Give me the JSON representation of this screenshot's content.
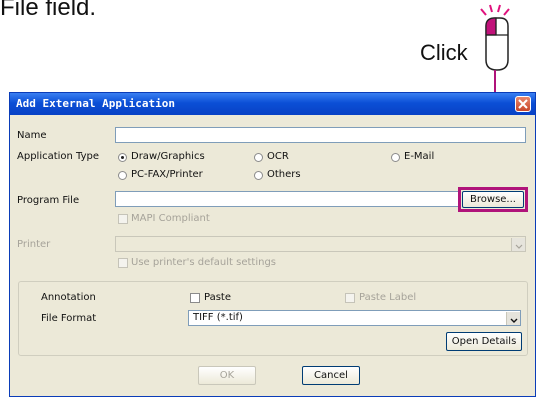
{
  "caption": "File field.",
  "click_label": "Click",
  "dialog": {
    "title": "Add External Application",
    "name_label": "Name",
    "name_value": "",
    "app_type_label": "Application Type",
    "types": {
      "draw": "Draw/Graphics",
      "ocr": "OCR",
      "email": "E-Mail",
      "pcfax": "PC-FAX/Printer",
      "others": "Others"
    },
    "program_file_label": "Program File",
    "program_file_value": "",
    "browse_label": "Browse...",
    "mapi_label": "MAPI Compliant",
    "printer_label": "Printer",
    "printer_value": "",
    "use_default_label": "Use printer's default settings",
    "annotation_label": "Annotation",
    "paste_label": "Paste",
    "paste_label_label": "Paste Label",
    "file_format_label": "File Format",
    "file_format_value": "TIFF (*.tif)",
    "open_details_label": "Open Details",
    "ok_label": "OK",
    "cancel_label": "Cancel"
  },
  "colors": {
    "highlight": "#b0137a",
    "titlebar": "#0b4fd6"
  }
}
